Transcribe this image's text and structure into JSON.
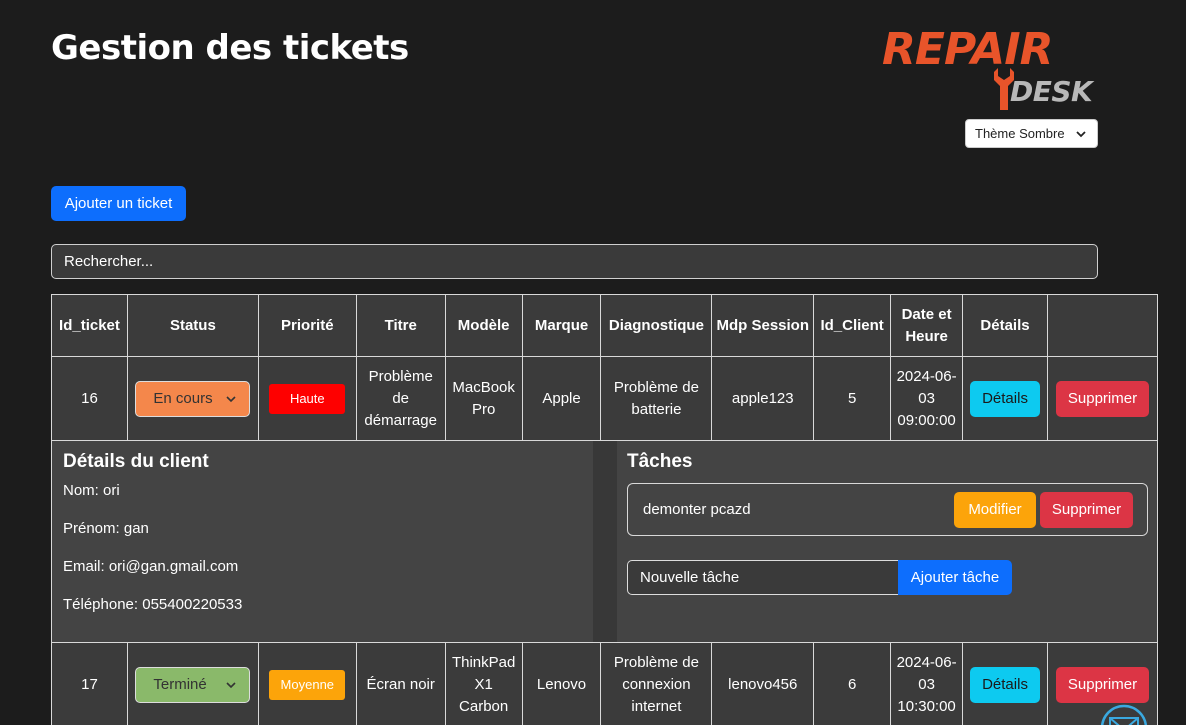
{
  "header": {
    "title": "Gestion des tickets",
    "logo_top": "REPAIR",
    "logo_bottom": "DESK",
    "theme_select": "Thème Sombre"
  },
  "toolbar": {
    "add_ticket_label": "Ajouter un ticket",
    "search_placeholder": "Rechercher..."
  },
  "table": {
    "headers": [
      "Id_ticket",
      "Status",
      "Priorité",
      "Titre",
      "Modèle",
      "Marque",
      "Diagnostique",
      "Mdp Session",
      "Id_Client",
      "Date et Heure",
      "Détails",
      ""
    ],
    "rows": [
      {
        "id": "16",
        "status": "En cours",
        "priority": "Haute",
        "title": "Problème de démarrage",
        "model": "MacBook Pro",
        "brand": "Apple",
        "diagnostic": "Problème de batterie",
        "session_pwd": "apple123",
        "client_id": "5",
        "datetime": "2024-06-03 09:00:00",
        "details_label": "Détails",
        "delete_label": "Supprimer"
      },
      {
        "id": "17",
        "status": "Terminé",
        "priority": "Moyenne",
        "title": "Écran noir",
        "model": "ThinkPad X1 Carbon",
        "brand": "Lenovo",
        "diagnostic": "Problème de connexion internet",
        "session_pwd": "lenovo456",
        "client_id": "6",
        "datetime": "2024-06-03 10:30:00",
        "details_label": "Détails",
        "delete_label": "Supprimer"
      }
    ]
  },
  "client_details": {
    "heading": "Détails du client",
    "name": "Nom: ori",
    "firstname": "Prénom: gan",
    "email": "Email: ori@gan.gmail.com",
    "phone": "Téléphone: 055400220533"
  },
  "tasks": {
    "heading": "Tâches",
    "items": [
      {
        "text": "demonter pcazd",
        "modify_label": "Modifier",
        "delete_label": "Supprimer"
      }
    ],
    "new_task_placeholder": "Nouvelle tâche",
    "add_task_label": "Ajouter tâche"
  },
  "colors": {
    "background": "#1c1c1c",
    "primary": "#0d6efd",
    "danger": "#dc3545",
    "info": "#0dcaf0",
    "warning": "#fca40a",
    "status_en_cours": "#f4874b",
    "status_termine": "#8ab96a",
    "priority_haute": "#fe0000",
    "logo_orange": "#e8542a",
    "mail_icon": "#3aa9e0"
  },
  "icons": {
    "theme_chevron": "chevron-down-icon",
    "status_chevron": "chevron-down-icon",
    "mail": "envelope-icon",
    "logo_wrench": "wrench-icon"
  }
}
